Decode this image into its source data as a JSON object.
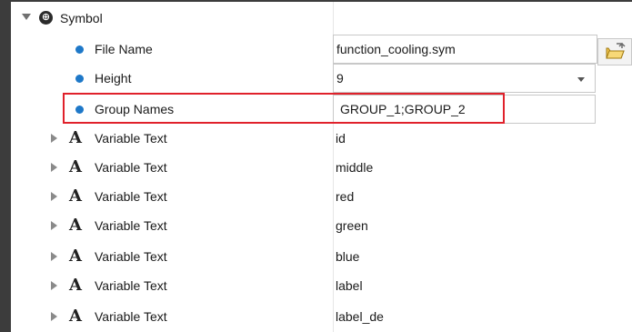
{
  "tree": {
    "root": {
      "label": "Symbol",
      "icon": "symbol-icon"
    },
    "properties": [
      {
        "label": "File Name",
        "value": "function_cooling.sym",
        "control": "browse"
      },
      {
        "label": "Height",
        "value": "9",
        "control": "dropdown"
      },
      {
        "label": "Group Names",
        "value": "GROUP_1;GROUP_2",
        "highlighted": true
      }
    ],
    "variable_texts": [
      {
        "label": "Variable Text",
        "value": "id"
      },
      {
        "label": "Variable Text",
        "value": "middle"
      },
      {
        "label": "Variable Text",
        "value": "red"
      },
      {
        "label": "Variable Text",
        "value": "green"
      },
      {
        "label": "Variable Text",
        "value": "blue"
      },
      {
        "label": "Variable Text",
        "value": "label"
      },
      {
        "label": "Variable Text",
        "value": "label_de"
      }
    ]
  },
  "colors": {
    "bullet": "#1e78c8",
    "highlight_border": "#e0212b",
    "frame": "#3c3c3c"
  }
}
